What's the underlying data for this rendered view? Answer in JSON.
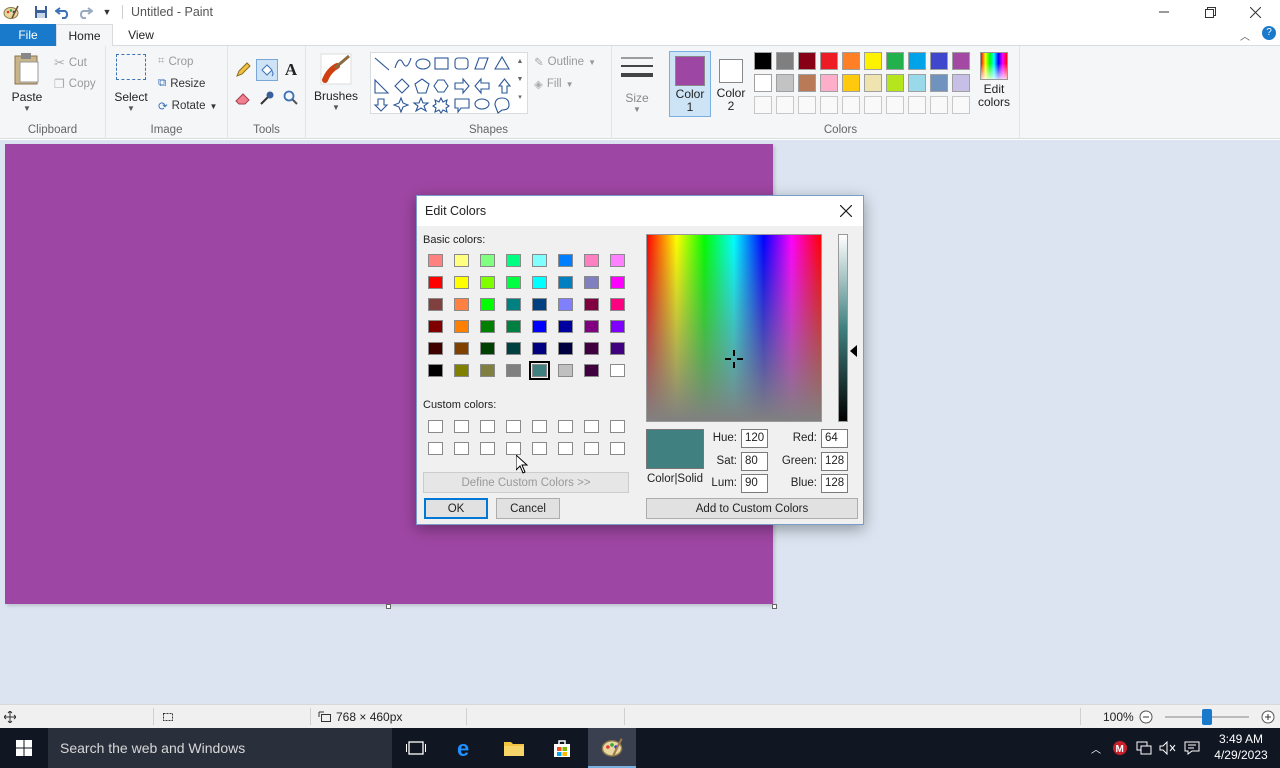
{
  "window": {
    "title": "Untitled - Paint"
  },
  "tabs": {
    "file": "File",
    "home": "Home",
    "view": "View"
  },
  "ribbon": {
    "clipboard": {
      "group": "Clipboard",
      "paste": "Paste",
      "cut": "Cut",
      "copy": "Copy"
    },
    "image": {
      "group": "Image",
      "select": "Select",
      "crop": "Crop",
      "resize": "Resize",
      "rotate": "Rotate"
    },
    "tools": {
      "group": "Tools"
    },
    "brushes": {
      "label": "Brushes"
    },
    "shapes": {
      "group": "Shapes",
      "outline": "Outline",
      "fill": "Fill"
    },
    "size": {
      "label": "Size"
    },
    "colors": {
      "group": "Colors",
      "color1_line1": "Color",
      "color1_line2": "1",
      "color2_line1": "Color",
      "color2_line2": "2",
      "edit_line1": "Edit",
      "edit_line2": "colors",
      "color1_value": "#9e46a3",
      "color2_value": "#ffffff",
      "palette_row1": [
        "#000000",
        "#7f7f7f",
        "#880015",
        "#ed1c24",
        "#ff7f27",
        "#fff200",
        "#22b14c",
        "#00a2e8",
        "#3f48cc",
        "#a349a4"
      ],
      "palette_row2": [
        "#ffffff",
        "#c3c3c3",
        "#b97a57",
        "#ffaec9",
        "#ffc90e",
        "#efe4b0",
        "#b5e61d",
        "#99d9ea",
        "#7092be",
        "#c8bfe7"
      ]
    }
  },
  "status": {
    "dimensions": "768 × 460px",
    "zoom": "100%"
  },
  "taskbar": {
    "search_placeholder": "Search the web and Windows",
    "time": "3:49 AM",
    "date": "4/29/2023"
  },
  "dialog": {
    "title": "Edit Colors",
    "basic_label": "Basic colors:",
    "custom_label": "Custom colors:",
    "define_button": "Define Custom Colors >>",
    "ok_button": "OK",
    "cancel_button": "Cancel",
    "add_button": "Add to Custom Colors",
    "color_solid": "Color|Solid",
    "preview_color": "#408080",
    "hue_label": "Hue:",
    "hue": "120",
    "sat_label": "Sat:",
    "sat": "80",
    "lum_label": "Lum:",
    "lum": "90",
    "red_label": "Red:",
    "red": "64",
    "green_label": "Green:",
    "green": "128",
    "blue_label": "Blue:",
    "blue": "128",
    "basic_colors": [
      "#ff8080",
      "#ffff80",
      "#80ff80",
      "#00ff80",
      "#80ffff",
      "#0080ff",
      "#ff80c0",
      "#ff80ff",
      "#ff0000",
      "#ffff00",
      "#80ff00",
      "#00ff40",
      "#00ffff",
      "#0080c0",
      "#8080c0",
      "#ff00ff",
      "#804040",
      "#ff8040",
      "#00ff00",
      "#008080",
      "#004080",
      "#8080ff",
      "#800040",
      "#ff0080",
      "#800000",
      "#ff8000",
      "#008000",
      "#008040",
      "#0000ff",
      "#0000a0",
      "#800080",
      "#8000ff",
      "#400000",
      "#804000",
      "#004000",
      "#004040",
      "#000080",
      "#000040",
      "#400040",
      "#400080",
      "#000000",
      "#808000",
      "#808040",
      "#808080",
      "#408080",
      "#c0c0c0",
      "#400040",
      "#ffffff"
    ],
    "selected_basic_index": 44
  }
}
